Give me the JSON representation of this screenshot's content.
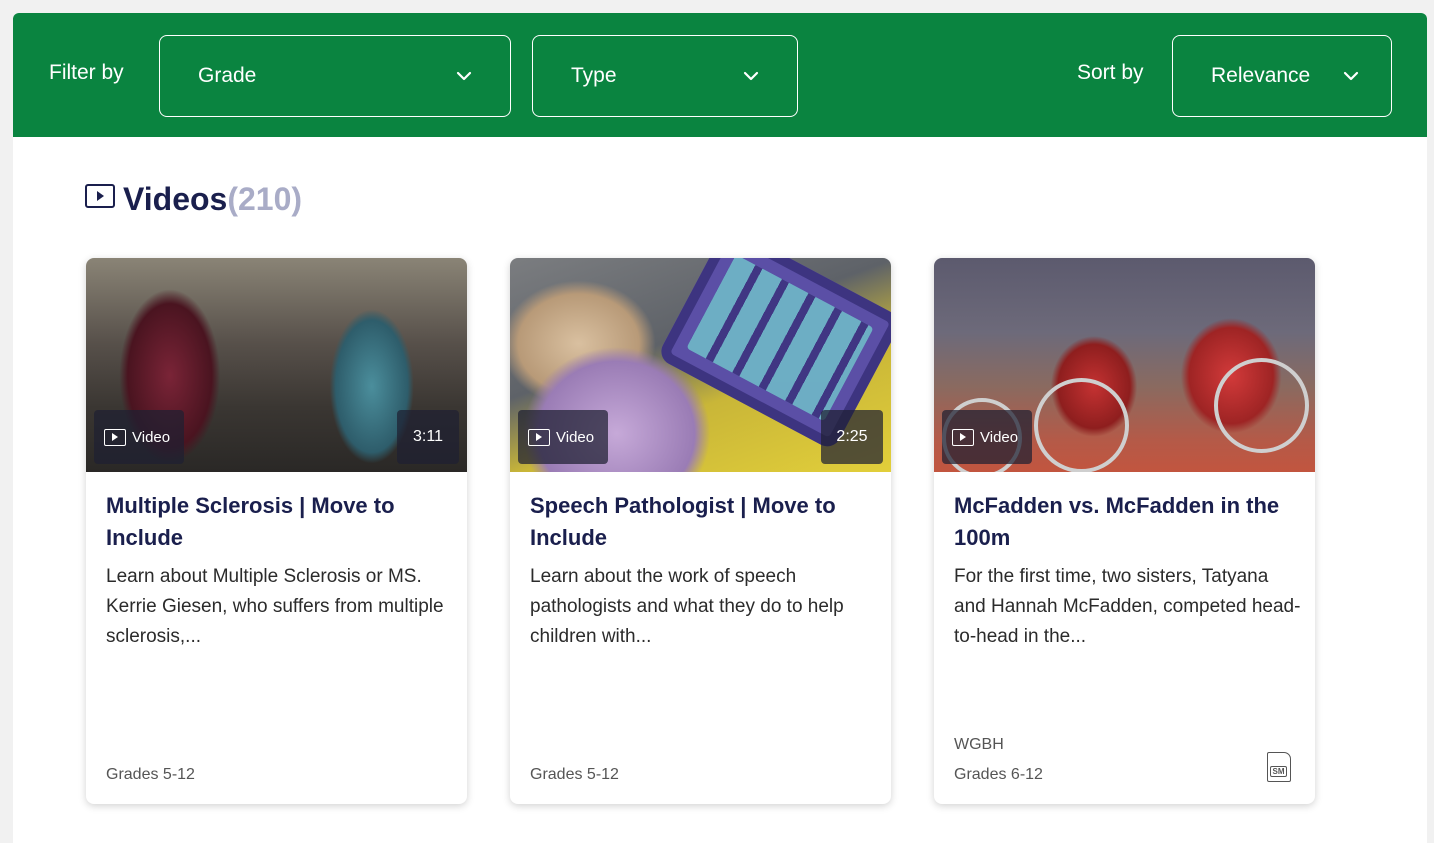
{
  "filters": {
    "filter_label": "Filter by",
    "grade_label": "Grade",
    "type_label": "Type",
    "sort_label": "Sort by",
    "sort_value": "Relevance"
  },
  "section": {
    "title": "Videos",
    "count": "(210)"
  },
  "cards": [
    {
      "badge": "Video",
      "duration": "3:11",
      "title": "Multiple Sclerosis | Move to Include",
      "description": "Learn about Multiple Sclerosis or MS. Kerrie Giesen, who suffers from multiple sclerosis,...",
      "source": "",
      "grades": "Grades 5-12"
    },
    {
      "badge": "Video",
      "duration": "2:25",
      "title": "Speech Pathologist | Move to Include",
      "description": "Learn about the work of speech pathologists and what they do to help children with...",
      "source": "",
      "grades": "Grades 5-12"
    },
    {
      "badge": "Video",
      "duration": "",
      "title": "McFadden vs. McFadden in the 100m",
      "description": "For the first time, two sisters, Tatyana and Hannah McFadden, competed head-to-head in the...",
      "source": "WGBH",
      "grades": "Grades 6-12",
      "doc_icon_label": "SM"
    }
  ],
  "colors": {
    "brand_green": "#0a8440",
    "title_navy": "#1a1f4d",
    "count_gray": "#a9acc7"
  },
  "icons": {
    "dropdown": "chevron-down-icon",
    "section": "video-play-icon",
    "badge": "video-play-icon",
    "resource": "document-icon"
  }
}
